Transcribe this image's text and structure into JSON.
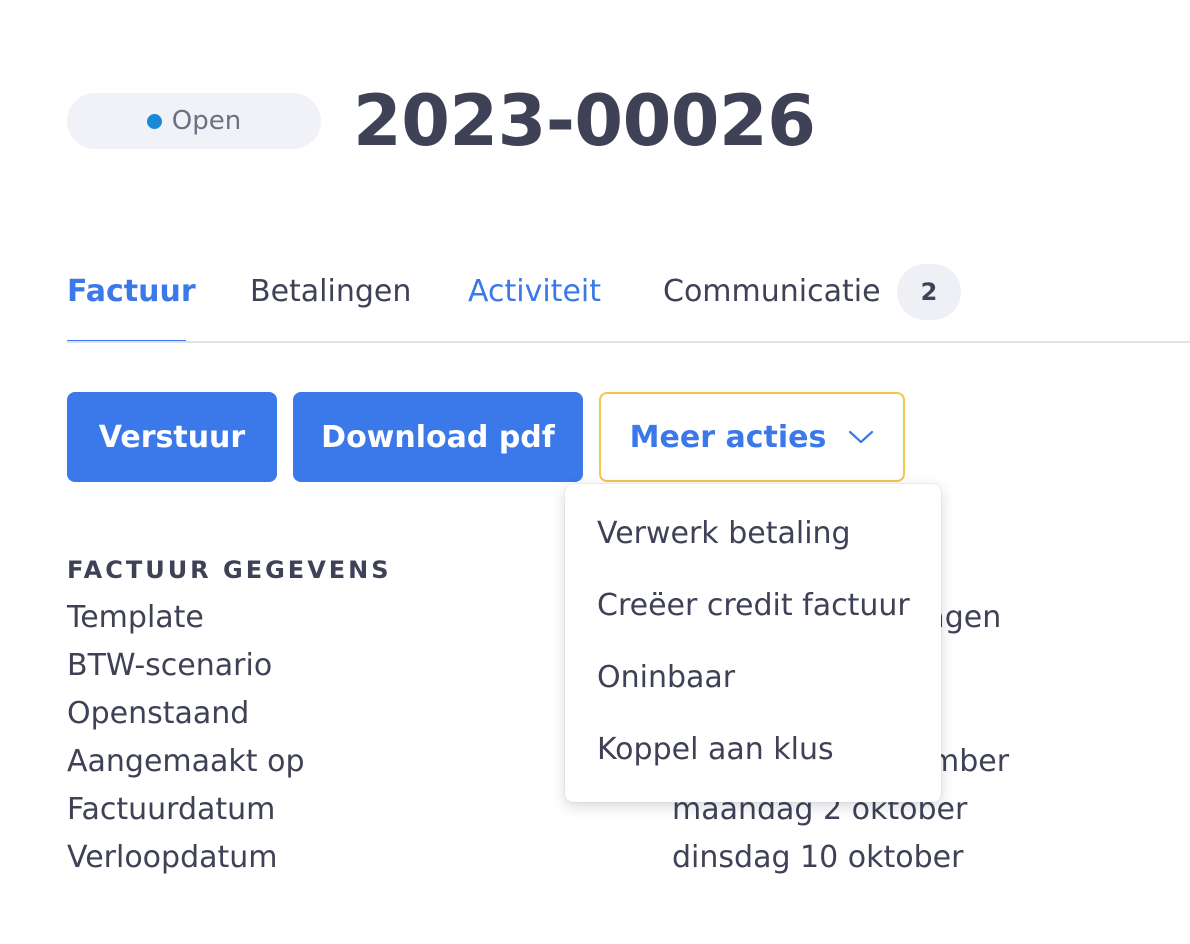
{
  "header": {
    "status_label": "Open",
    "status_color": "#1a8ad8",
    "invoice_number": "2023-00026"
  },
  "tabs": [
    {
      "label": "Factuur",
      "active": true
    },
    {
      "label": "Betalingen",
      "active": false
    },
    {
      "label": "Activiteit",
      "active": false
    },
    {
      "label": "Communicatie",
      "active": false,
      "badge": "2"
    }
  ],
  "actions": {
    "send_label": "Verstuur",
    "pdf_label": "Download pdf",
    "more_label": "Meer acties",
    "more_icon": "chevron-down-icon"
  },
  "dropdown": {
    "items": [
      "Verwerk betaling",
      "Creëer credit factuur",
      "Oninbaar",
      "Koppel aan klus"
    ]
  },
  "details": {
    "heading": "FACTUUR GEGEVENS",
    "rows": [
      {
        "label": "Template",
        "value": "lagen"
      },
      {
        "label": "BTW-scenario",
        "value": ""
      },
      {
        "label": "Openstaand",
        "value": ""
      },
      {
        "label": "Aangemaakt op",
        "value": "mber"
      },
      {
        "label": "Factuurdatum",
        "value": "maandag 2 oktober"
      },
      {
        "label": "Verloopdatum",
        "value": "dinsdag 10 oktober"
      }
    ]
  },
  "colors": {
    "accent": "#3b78ea",
    "text": "#3f4156",
    "focus_border": "#f5c451"
  }
}
